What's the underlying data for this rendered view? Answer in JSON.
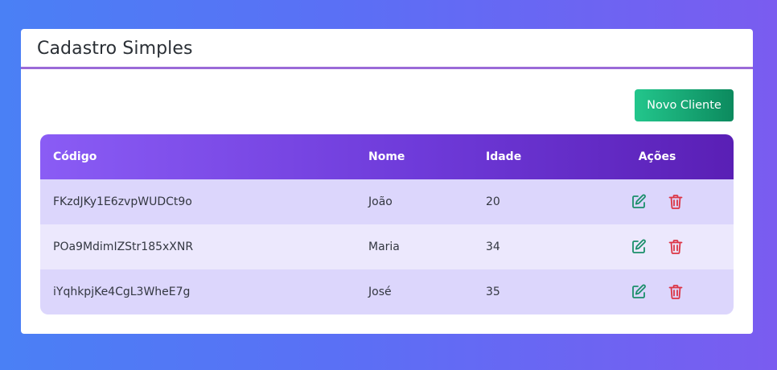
{
  "header": {
    "title": "Cadastro Simples"
  },
  "toolbar": {
    "new_client_label": "Novo Cliente"
  },
  "table": {
    "columns": [
      "Código",
      "Nome",
      "Idade",
      "Ações"
    ],
    "rows": [
      {
        "code": "FKzdJKy1E6zvpWUDCt9o",
        "name": "João",
        "age": "20"
      },
      {
        "code": "POa9MdimIZStr185xXNR",
        "name": "Maria",
        "age": "34"
      },
      {
        "code": "iYqhkpjKe4CgL3WheE7g",
        "name": "José",
        "age": "35"
      }
    ],
    "row_actions": [
      {
        "icon": "edit-icon",
        "color": "#1a8f6a"
      },
      {
        "icon": "trash-icon",
        "color": "#dc3545"
      }
    ]
  },
  "colors": {
    "accent": "#9a6ad8",
    "header_gradient_start": "#8a5cf5",
    "header_gradient_end": "#5a1fb5",
    "button_gradient_start": "#23c68c",
    "button_gradient_end": "#0c8a5e",
    "row_odd": "#dcd6fc",
    "row_even": "#ece8fd"
  }
}
